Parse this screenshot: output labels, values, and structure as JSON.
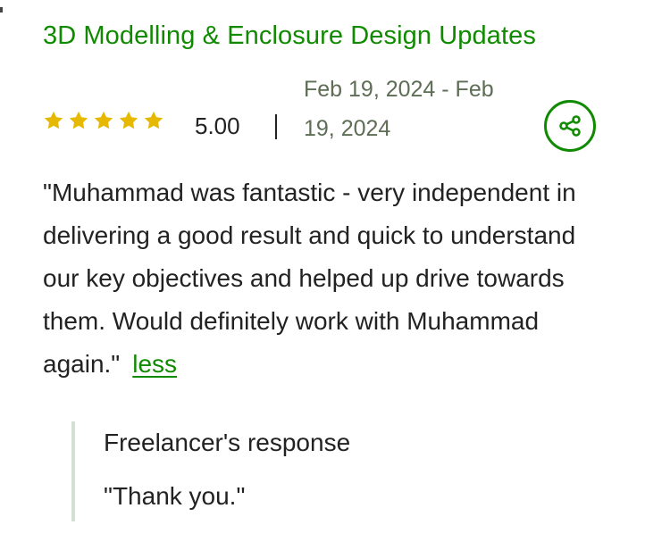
{
  "colors": {
    "accent": "#108a00",
    "star": "#e6b800",
    "text": "#222222",
    "muted": "#5e6d55",
    "response_border": "#d5e0d5"
  },
  "review_card": {
    "title": "3D Modelling & Enclosure Design Updates",
    "rating": {
      "stars": 5,
      "max_stars": 5,
      "value_text": "5.00"
    },
    "date_range": "Feb 19, 2024 - Feb 19, 2024",
    "share_icon": "share-icon",
    "review_text": "\"Muhammad was fantastic - very independent in delivering a good result and quick to understand our key objectives and helped up drive towards them. Would definitely work with Muhammad again.\"",
    "less_link": "less",
    "freelancer_response": {
      "title": "Freelancer's response",
      "text": "\"Thank you.\""
    }
  }
}
